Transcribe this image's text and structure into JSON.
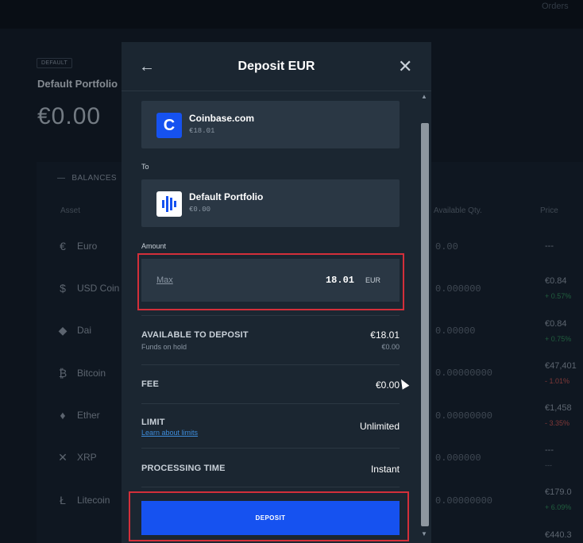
{
  "background": {
    "orders_label": "Orders",
    "badge": "DEFAULT",
    "portfolio_name": "Default Portfolio",
    "balance": "€0.00",
    "balances_title": "BALANCES",
    "columns": {
      "asset": "Asset",
      "available_qty": "Available Qty.",
      "price": "Price"
    },
    "rows": [
      {
        "icon": "euro-icon",
        "name": "Euro",
        "qty": "0.00",
        "price": "---",
        "change": ""
      },
      {
        "icon": "usd-coin-icon",
        "name": "USD Coin",
        "qty": "0.000000",
        "price": "€0.84",
        "change": "+ 0.57%"
      },
      {
        "icon": "dai-icon",
        "name": "Dai",
        "qty": "0.00000",
        "price": "€0.84",
        "change": "+ 0.75%"
      },
      {
        "icon": "bitcoin-icon",
        "name": "Bitcoin",
        "qty": "0.00000000",
        "price": "€47,401",
        "change": "- 1.01%"
      },
      {
        "icon": "ether-icon",
        "name": "Ether",
        "qty": "0.00000000",
        "price": "€1,458",
        "change": "- 3.35%"
      },
      {
        "icon": "xrp-icon",
        "name": "XRP",
        "qty": "0.000000",
        "price": "---",
        "change": "---"
      },
      {
        "icon": "litecoin-icon",
        "name": "Litecoin",
        "qty": "0.00000000",
        "price": "€179.0",
        "change": "+ 6.09%"
      },
      {
        "icon": "coin-icon",
        "name": "",
        "qty": "",
        "price": "€440.3",
        "change": ""
      }
    ]
  },
  "modal": {
    "title": "Deposit EUR",
    "from": {
      "icon_letter": "C",
      "name": "Coinbase.com",
      "amount": "€18.01"
    },
    "to_label": "To",
    "to": {
      "name": "Default Portfolio",
      "amount": "€0.00"
    },
    "amount_label": "Amount",
    "amount": {
      "max_label": "Max",
      "value": "18.01",
      "currency": "EUR"
    },
    "available": {
      "label": "AVAILABLE TO DEPOSIT",
      "value": "€18.01",
      "sub_label": "Funds on hold",
      "sub_value": "€0.00"
    },
    "fee": {
      "label": "FEE",
      "value": "€0.00"
    },
    "limit": {
      "label": "LIMIT",
      "link": "Learn about limits",
      "value": "Unlimited"
    },
    "processing": {
      "label": "PROCESSING TIME",
      "value": "Instant"
    },
    "deposit_button": "DEPOSIT"
  },
  "colors": {
    "accent": "#1652f0",
    "highlight": "#d32f3a",
    "up": "#2e8b57",
    "down": "#c0504d"
  }
}
